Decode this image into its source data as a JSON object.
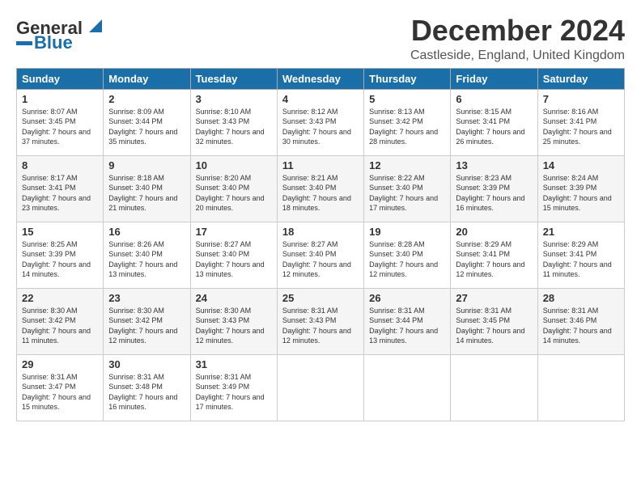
{
  "logo": {
    "line1": "General",
    "line2": "Blue"
  },
  "title": "December 2024",
  "location": "Castleside, England, United Kingdom",
  "days_of_week": [
    "Sunday",
    "Monday",
    "Tuesday",
    "Wednesday",
    "Thursday",
    "Friday",
    "Saturday"
  ],
  "weeks": [
    [
      {
        "day": "1",
        "sunrise": "8:07 AM",
        "sunset": "3:45 PM",
        "daylight": "7 hours and 37 minutes."
      },
      {
        "day": "2",
        "sunrise": "8:09 AM",
        "sunset": "3:44 PM",
        "daylight": "7 hours and 35 minutes."
      },
      {
        "day": "3",
        "sunrise": "8:10 AM",
        "sunset": "3:43 PM",
        "daylight": "7 hours and 32 minutes."
      },
      {
        "day": "4",
        "sunrise": "8:12 AM",
        "sunset": "3:43 PM",
        "daylight": "7 hours and 30 minutes."
      },
      {
        "day": "5",
        "sunrise": "8:13 AM",
        "sunset": "3:42 PM",
        "daylight": "7 hours and 28 minutes."
      },
      {
        "day": "6",
        "sunrise": "8:15 AM",
        "sunset": "3:41 PM",
        "daylight": "7 hours and 26 minutes."
      },
      {
        "day": "7",
        "sunrise": "8:16 AM",
        "sunset": "3:41 PM",
        "daylight": "7 hours and 25 minutes."
      }
    ],
    [
      {
        "day": "8",
        "sunrise": "8:17 AM",
        "sunset": "3:41 PM",
        "daylight": "7 hours and 23 minutes."
      },
      {
        "day": "9",
        "sunrise": "8:18 AM",
        "sunset": "3:40 PM",
        "daylight": "7 hours and 21 minutes."
      },
      {
        "day": "10",
        "sunrise": "8:20 AM",
        "sunset": "3:40 PM",
        "daylight": "7 hours and 20 minutes."
      },
      {
        "day": "11",
        "sunrise": "8:21 AM",
        "sunset": "3:40 PM",
        "daylight": "7 hours and 18 minutes."
      },
      {
        "day": "12",
        "sunrise": "8:22 AM",
        "sunset": "3:40 PM",
        "daylight": "7 hours and 17 minutes."
      },
      {
        "day": "13",
        "sunrise": "8:23 AM",
        "sunset": "3:39 PM",
        "daylight": "7 hours and 16 minutes."
      },
      {
        "day": "14",
        "sunrise": "8:24 AM",
        "sunset": "3:39 PM",
        "daylight": "7 hours and 15 minutes."
      }
    ],
    [
      {
        "day": "15",
        "sunrise": "8:25 AM",
        "sunset": "3:39 PM",
        "daylight": "7 hours and 14 minutes."
      },
      {
        "day": "16",
        "sunrise": "8:26 AM",
        "sunset": "3:40 PM",
        "daylight": "7 hours and 13 minutes."
      },
      {
        "day": "17",
        "sunrise": "8:27 AM",
        "sunset": "3:40 PM",
        "daylight": "7 hours and 13 minutes."
      },
      {
        "day": "18",
        "sunrise": "8:27 AM",
        "sunset": "3:40 PM",
        "daylight": "7 hours and 12 minutes."
      },
      {
        "day": "19",
        "sunrise": "8:28 AM",
        "sunset": "3:40 PM",
        "daylight": "7 hours and 12 minutes."
      },
      {
        "day": "20",
        "sunrise": "8:29 AM",
        "sunset": "3:41 PM",
        "daylight": "7 hours and 12 minutes."
      },
      {
        "day": "21",
        "sunrise": "8:29 AM",
        "sunset": "3:41 PM",
        "daylight": "7 hours and 11 minutes."
      }
    ],
    [
      {
        "day": "22",
        "sunrise": "8:30 AM",
        "sunset": "3:42 PM",
        "daylight": "7 hours and 11 minutes."
      },
      {
        "day": "23",
        "sunrise": "8:30 AM",
        "sunset": "3:42 PM",
        "daylight": "7 hours and 12 minutes."
      },
      {
        "day": "24",
        "sunrise": "8:30 AM",
        "sunset": "3:43 PM",
        "daylight": "7 hours and 12 minutes."
      },
      {
        "day": "25",
        "sunrise": "8:31 AM",
        "sunset": "3:43 PM",
        "daylight": "7 hours and 12 minutes."
      },
      {
        "day": "26",
        "sunrise": "8:31 AM",
        "sunset": "3:44 PM",
        "daylight": "7 hours and 13 minutes."
      },
      {
        "day": "27",
        "sunrise": "8:31 AM",
        "sunset": "3:45 PM",
        "daylight": "7 hours and 14 minutes."
      },
      {
        "day": "28",
        "sunrise": "8:31 AM",
        "sunset": "3:46 PM",
        "daylight": "7 hours and 14 minutes."
      }
    ],
    [
      {
        "day": "29",
        "sunrise": "8:31 AM",
        "sunset": "3:47 PM",
        "daylight": "7 hours and 15 minutes."
      },
      {
        "day": "30",
        "sunrise": "8:31 AM",
        "sunset": "3:48 PM",
        "daylight": "7 hours and 16 minutes."
      },
      {
        "day": "31",
        "sunrise": "8:31 AM",
        "sunset": "3:49 PM",
        "daylight": "7 hours and 17 minutes."
      },
      null,
      null,
      null,
      null
    ]
  ]
}
